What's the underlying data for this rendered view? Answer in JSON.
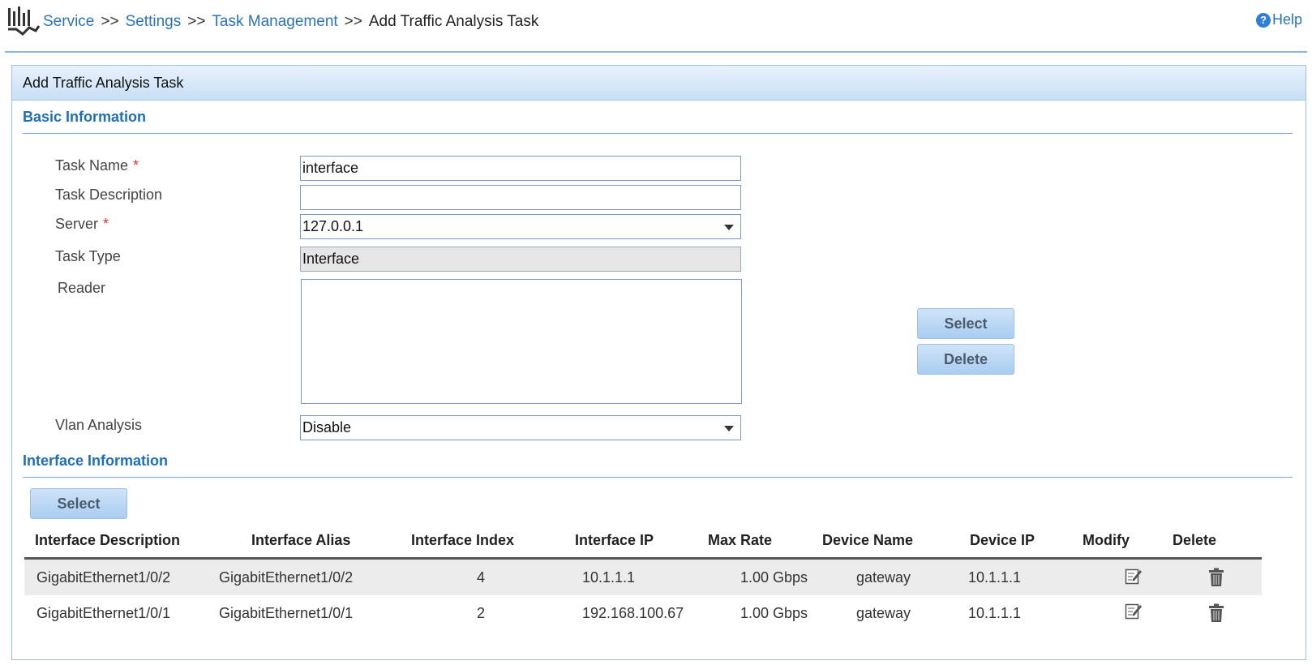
{
  "breadcrumb": {
    "items": [
      "Service",
      "Settings",
      "Task Management"
    ],
    "separator": ">>",
    "current": "Add Traffic Analysis Task"
  },
  "help_label": "Help",
  "panel_title": "Add Traffic Analysis Task",
  "basic_section": {
    "title": "Basic Information",
    "task_name_label": "Task Name",
    "task_name_value": "interface",
    "task_description_label": "Task Description",
    "task_description_value": "",
    "server_label": "Server",
    "server_value": "127.0.0.1",
    "task_type_label": "Task Type",
    "task_type_value": "Interface",
    "reader_label": "Reader",
    "reader_select_button": "Select",
    "reader_delete_button": "Delete",
    "vlan_label": "Vlan Analysis",
    "vlan_value": "Disable"
  },
  "required_marker": "*",
  "interface_section": {
    "title": "Interface Information",
    "select_button": "Select",
    "columns": [
      "Interface Description",
      "Interface Alias",
      "Interface Index",
      "Interface IP",
      "Max Rate",
      "Device Name",
      "Device IP",
      "Modify",
      "Delete"
    ],
    "rows": [
      {
        "description": "GigabitEthernet1/0/2",
        "alias": "GigabitEthernet1/0/2",
        "index": "4",
        "ip": "10.1.1.1",
        "max_rate": "1.00 Gbps",
        "device_name": "gateway",
        "device_ip": "10.1.1.1"
      },
      {
        "description": "GigabitEthernet1/0/1",
        "alias": "GigabitEthernet1/0/1",
        "index": "2",
        "ip": "192.168.100.67",
        "max_rate": "1.00 Gbps",
        "device_name": "gateway",
        "device_ip": "10.1.1.1"
      }
    ]
  },
  "icons": {
    "logo": "traffic-chart-icon",
    "help": "question-circle-icon",
    "modify": "edit-icon",
    "delete": "trash-icon"
  },
  "colors": {
    "link": "#2a74bd",
    "section_title": "#1f6fb8",
    "required": "#dd3333"
  }
}
